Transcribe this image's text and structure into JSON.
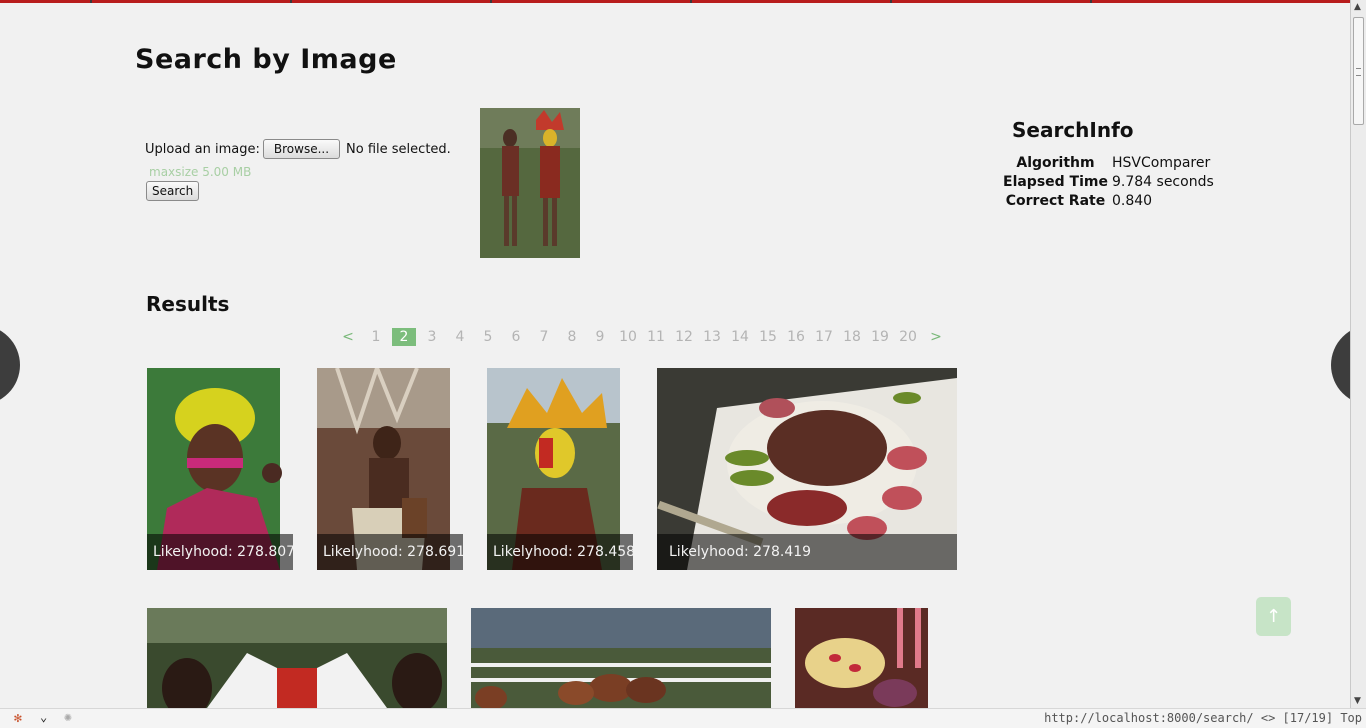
{
  "page": {
    "title": "Search by Image"
  },
  "upload": {
    "label": "Upload an image:",
    "browse_label": "Browse...",
    "file_status": "No file selected.",
    "maxsize": "maxsize 5.00 MB",
    "search_label": "Search"
  },
  "search_info": {
    "title": "SearchInfo",
    "rows": [
      {
        "key": "Algorithm",
        "value": "HSVComparer"
      },
      {
        "key": "Elapsed Time",
        "value": "9.784 seconds"
      },
      {
        "key": "Correct Rate",
        "value": "0.840"
      }
    ]
  },
  "results": {
    "title": "Results",
    "pager": {
      "prev": "<",
      "next": ">",
      "pages": [
        "1",
        "2",
        "3",
        "4",
        "5",
        "6",
        "7",
        "8",
        "9",
        "10",
        "11",
        "12",
        "13",
        "14",
        "15",
        "16",
        "17",
        "18",
        "19",
        "20"
      ],
      "current": "2"
    },
    "items": [
      {
        "caption": "Likelyhood: 278.807"
      },
      {
        "caption": "Likelyhood: 278.691"
      },
      {
        "caption": "Likelyhood: 278.458"
      },
      {
        "caption": "Likelyhood: 278.419"
      },
      {
        "caption": ""
      },
      {
        "caption": ""
      },
      {
        "caption": ""
      }
    ]
  },
  "back_to_top": "↑",
  "statusbar": {
    "url": "http://localhost:8000/search/ <> [17/19] Top"
  },
  "colors": {
    "accent_green": "#7cbd7c",
    "caption_bg": "rgba(0,0,0,0.55)",
    "top_strip": "#b81c1c"
  }
}
